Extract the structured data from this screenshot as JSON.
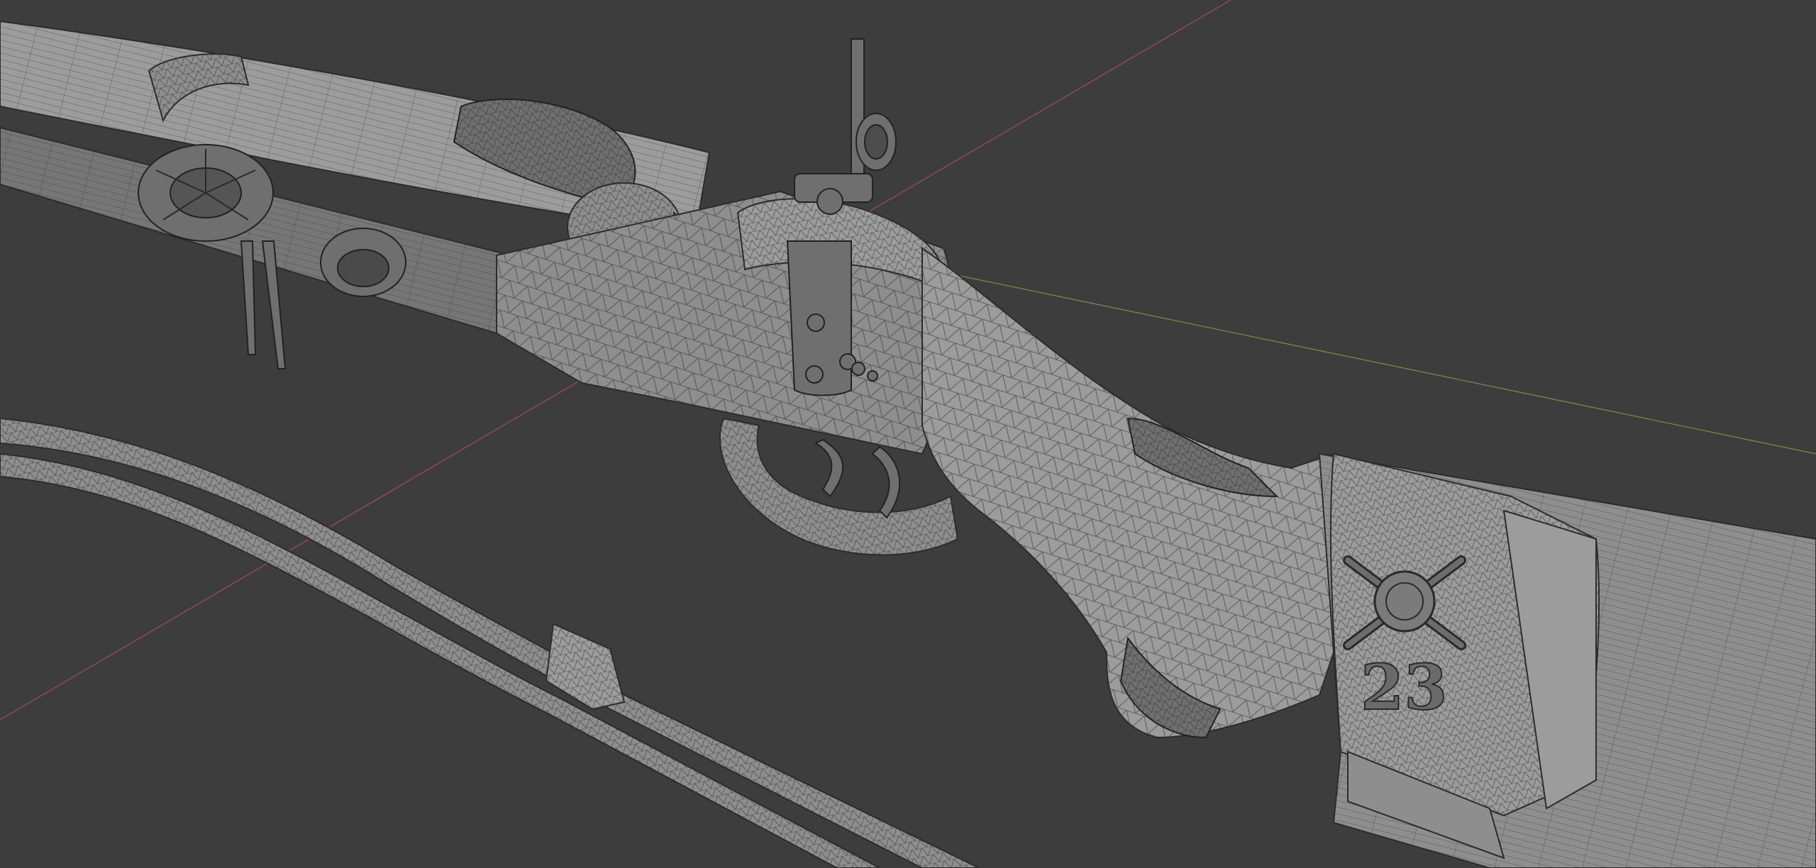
{
  "viewport": {
    "background_color": "#3d3d3d",
    "mode": "wireframe-overlay",
    "axis_x_color": "#b0505a",
    "axis_y_color": "#7d9a46"
  },
  "model": {
    "object": "rifle",
    "engraving_number": "23",
    "emblem_icon": "crossed-cannons-icon",
    "mesh_color": "#8e8e8e",
    "wire_color": "#2a2a2a"
  }
}
